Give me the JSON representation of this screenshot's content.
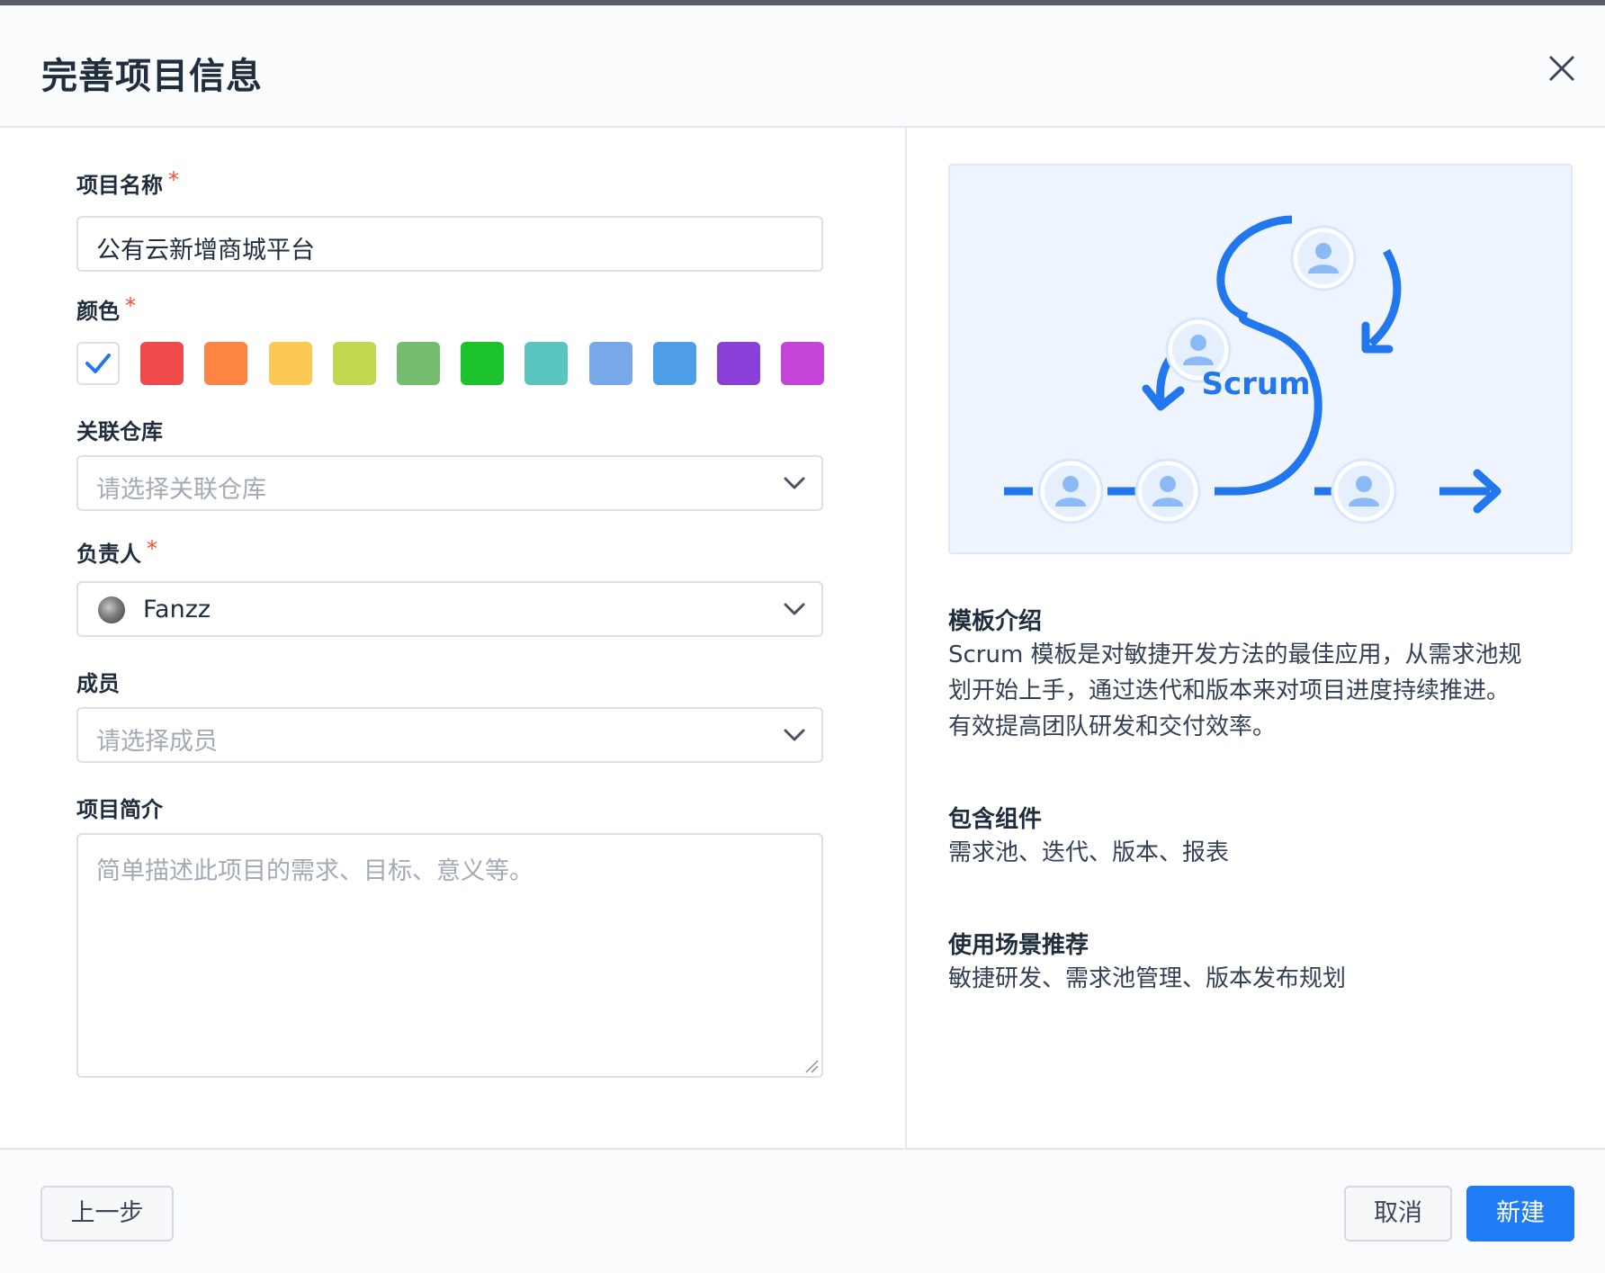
{
  "dialog": {
    "title": "完善项目信息",
    "close_icon": "close-icon"
  },
  "form": {
    "name": {
      "label": "项目名称",
      "required_mark": "*",
      "value": "公有云新增商城平台"
    },
    "color": {
      "label": "颜色",
      "required_mark": "*",
      "swatches": [
        "#ffffff",
        "#f04b4b",
        "#fd8443",
        "#fdc955",
        "#c2d84f",
        "#76bc70",
        "#1cc22c",
        "#5bc6bf",
        "#78a8e8",
        "#4d9ee6",
        "#8a3fd8",
        "#c545d9"
      ],
      "selected_index": 0
    },
    "repo": {
      "label": "关联仓库",
      "placeholder": "请选择关联仓库"
    },
    "owner": {
      "label": "负责人",
      "required_mark": "*",
      "value": "Fanzz"
    },
    "members": {
      "label": "成员",
      "placeholder": "请选择成员"
    },
    "intro": {
      "label": "项目简介",
      "placeholder": "简单描述此项目的需求、目标、意义等。"
    }
  },
  "template": {
    "illustration_label": "Scrum",
    "intro_title": "模板介绍",
    "intro_lines": [
      "Scrum 模板是对敏捷开发方法的最佳应用，从需求池规",
      "划开始上手，通过迭代和版本来对项目进度持续推进。",
      "有效提高团队研发和交付效率。"
    ],
    "components_title": "包含组件",
    "components_text": "需求池、迭代、版本、报表",
    "scenario_title": "使用场景推荐",
    "scenario_text": "敏捷研发、需求池管理、版本发布规划"
  },
  "footer": {
    "prev_label": "上一步",
    "cancel_label": "取消",
    "create_label": "新建"
  },
  "colors": {
    "accent": "#1f7cf4",
    "required": "#f0503a",
    "illustration_blue": "#2377ee"
  }
}
